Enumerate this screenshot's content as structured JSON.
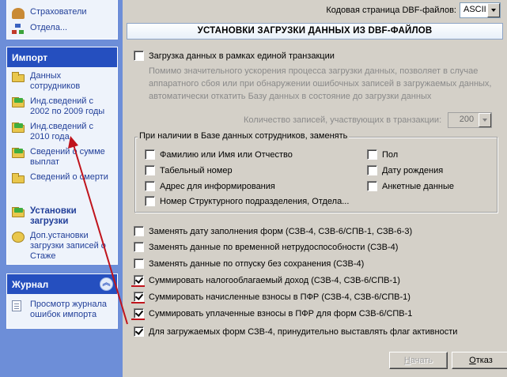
{
  "sidebar": {
    "top_items": [
      {
        "label": "Страхователи"
      },
      {
        "label": "Отдела..."
      }
    ],
    "import_group": {
      "title": "Импорт",
      "items": [
        {
          "label": "Данных сотрудников"
        },
        {
          "label": "Инд.сведений с 2002 по 2009 годы"
        },
        {
          "label": "Инд.сведений с 2010 года"
        },
        {
          "label": "Сведений о сумме выплат"
        },
        {
          "label": "Сведений о смерти"
        },
        {
          "label": "Установки загрузки"
        },
        {
          "label": "Доп.установки загрузки записей о Стаже"
        }
      ]
    },
    "journal_group": {
      "title": "Журнал",
      "collapse_icon": "double-chevron-up-icon",
      "items": [
        {
          "label": "Просмотр журнала ошибок импорта"
        }
      ]
    }
  },
  "codepage": {
    "label": "Кодовая страница DBF-файлов:",
    "value": "ASCII"
  },
  "banner": "УСТАНОВКИ ЗАГРУЗКИ ДАННЫХ ИЗ DBF-ФАЙЛОВ",
  "transaction": {
    "label": "Загрузка данных в рамках единой транзакции",
    "checked": false,
    "description": "Помимо значительного ускорения процесса загрузки данных, позволяет в случае аппаратного сбоя или при обнаружении ошибочных записей в загружаемых данных, автоматически откатить Базу данных в состояние до загрузки данных",
    "count_label": "Количество записей, участвующих в транзакции:",
    "count_value": "200"
  },
  "replace_group": {
    "title": "При наличии в Базе данных сотрудников, заменять",
    "items": [
      {
        "label": "Фамилию или Имя или Отчество",
        "checked": false
      },
      {
        "label": "Табельный номер",
        "checked": false
      },
      {
        "label": "Адрес для информирования",
        "checked": false
      },
      {
        "label": "Номер Структурного подразделения, Отдела...",
        "checked": false
      },
      {
        "label": "Пол",
        "checked": false
      },
      {
        "label": "Дату рождения",
        "checked": false
      },
      {
        "label": "Анкетные данные",
        "checked": false
      }
    ]
  },
  "options": [
    {
      "label": "Заменять дату заполнения форм (СЗВ-4, СЗВ-6/СПВ-1, СЗВ-6-3)",
      "checked": false
    },
    {
      "label": "Заменять данные по временной нетрудоспособности (СЗВ-4)",
      "checked": false
    },
    {
      "label": "Заменять данные по отпуску без сохранения (СЗВ-4)",
      "checked": false
    },
    {
      "label": "Суммировать налогооблагаемый доход (СЗВ-4, СЗВ-6/СПВ-1)",
      "checked": true
    },
    {
      "label": "Суммировать начисленные взносы в ПФР (СЗВ-4, СЗВ-6/СПВ-1)",
      "checked": true
    },
    {
      "label": "Суммировать уплаченные взносы в ПФР для форм СЗВ-6/СПВ-1",
      "checked": true
    },
    {
      "label": "Для загружаемых форм СЗВ-4, принудительно выставлять флаг активности",
      "checked": true
    }
  ],
  "buttons": {
    "start": "Начать",
    "start_access": "Н",
    "start_rest": "ачать",
    "exit": "Отказ",
    "exit_access": "О",
    "exit_rest": "тказ"
  },
  "colors": {
    "annotation": "#c0141c",
    "sidebar_bg": "#6d8ed8",
    "group_header": "#254fbf"
  }
}
